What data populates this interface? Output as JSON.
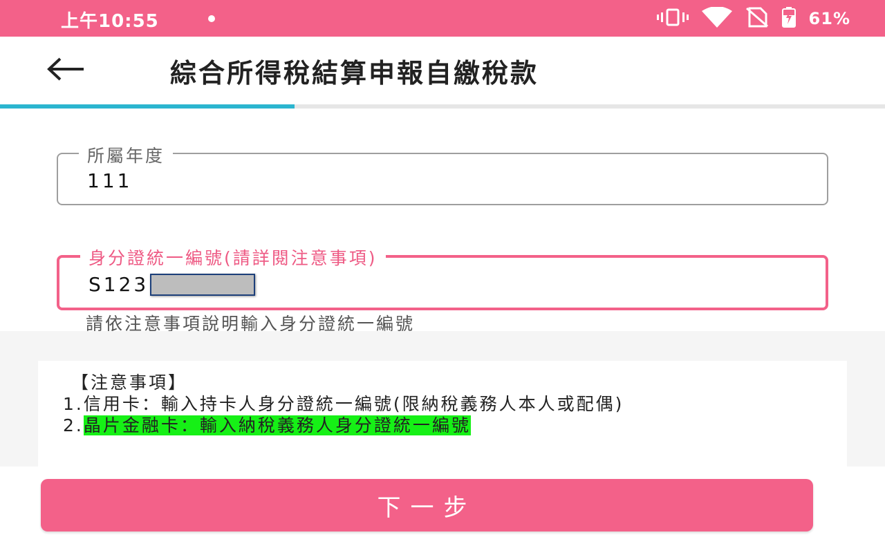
{
  "status_bar": {
    "time": "上午10:55",
    "battery_percent": "61%",
    "icons": [
      "vibrate-icon",
      "wifi-icon",
      "no-sim-icon",
      "battery-charging-icon"
    ]
  },
  "header": {
    "title": "綜合所得稅結算申報自繳稅款"
  },
  "progress": {
    "fraction": 0.333
  },
  "form": {
    "year_label": "所屬年度",
    "year_value": "111",
    "id_label": "身分證統一編號(請詳閱注意事項)",
    "id_value": "S123",
    "id_helper": "請依注意事項說明輸入身分證統一編號"
  },
  "notes": {
    "title": "【注意事項】",
    "item1": "1.信用卡：輸入持卡人身分證統一編號(限納稅義務人本人或配偶)",
    "item2_prefix": "2.",
    "item2_text": "晶片金融卡：輸入納稅義務人身分證統一編號"
  },
  "actions": {
    "next_label": "下一步"
  },
  "colors": {
    "accent": "#f36189",
    "progress": "#2bb5cf",
    "highlight": "#16f016"
  }
}
